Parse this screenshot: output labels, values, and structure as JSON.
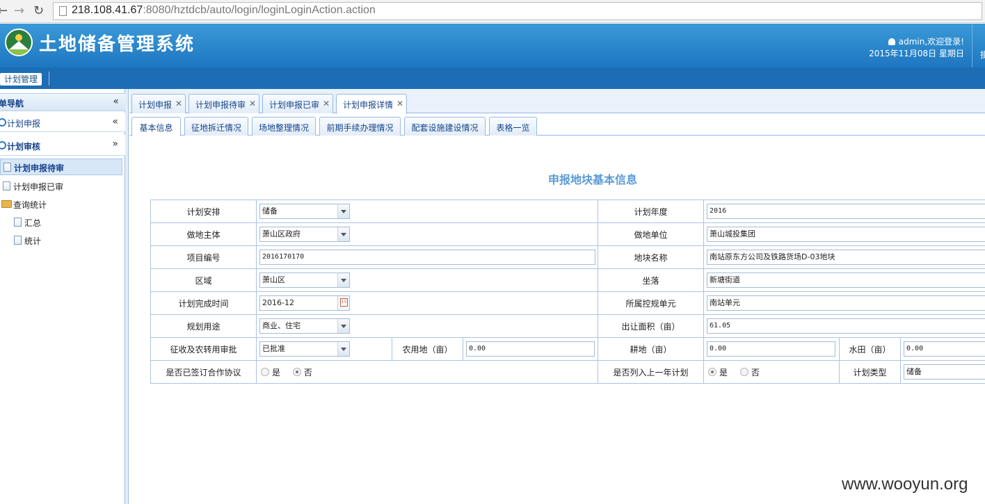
{
  "browser": {
    "url_host": "218.108.41.67",
    "url_rest": ":8080/hztdcb/auto/login/loginLoginAction.action"
  },
  "header": {
    "title": "土地储备管理系统",
    "user_greeting": "admin,欢迎登录!",
    "date": "2015年11月08日 星期日",
    "edge_text": "掛"
  },
  "module_bar": {
    "tab": "计划管理"
  },
  "sidebar": {
    "title": "菜单导航",
    "sections": [
      {
        "label": "计划申报"
      },
      {
        "label": "计划审核"
      }
    ],
    "tree": [
      {
        "label": "计划申报待审"
      },
      {
        "label": "计划申报已审"
      },
      {
        "label": "查询统计"
      },
      {
        "label": "汇总"
      },
      {
        "label": "统计"
      }
    ]
  },
  "tabs": [
    {
      "label": "计划申报"
    },
    {
      "label": "计划申报待审"
    },
    {
      "label": "计划申报已审"
    },
    {
      "label": "计划申报详情"
    }
  ],
  "subtabs": [
    {
      "label": "基本信息"
    },
    {
      "label": "征地拆迁情况"
    },
    {
      "label": "场地整理情况"
    },
    {
      "label": "前期手续办理情况"
    },
    {
      "label": "配套设施建设情况"
    },
    {
      "label": "表格一览"
    }
  ],
  "form": {
    "title": "申报地块基本信息",
    "plan_arrangement": {
      "label": "计划安排",
      "value": "储备"
    },
    "plan_year": {
      "label": "计划年度",
      "value": "2016"
    },
    "land_subject": {
      "label": "做地主体",
      "value": "萧山区政府"
    },
    "land_unit": {
      "label": "做地单位",
      "value": "萧山城投集团"
    },
    "project_no": {
      "label": "项目编号",
      "value": "2016170170"
    },
    "parcel_name": {
      "label": "地块名称",
      "value": "南站原东方公司及铁路货场D-03地块"
    },
    "area": {
      "label": "区域",
      "value": "萧山区"
    },
    "location": {
      "label": "坐落",
      "value": "新塘街道"
    },
    "completion_time": {
      "label": "计划完成时间",
      "value": "2016-12"
    },
    "control_unit": {
      "label": "所属控规单元",
      "value": "南站单元"
    },
    "planned_use": {
      "label": "规划用途",
      "value": "商业、住宅"
    },
    "transfer_area": {
      "label": "出让面积（亩）",
      "value": "61.05"
    },
    "approval": {
      "label": "征收及农转用审批",
      "value": "已批准"
    },
    "farmland": {
      "label": "农用地（亩）",
      "value": "0.00"
    },
    "cultivated": {
      "label": "耕地（亩）",
      "value": "0.00"
    },
    "paddy": {
      "label": "水田（亩）",
      "value": "0.00"
    },
    "signed_agreement": {
      "label": "是否已签订合作协议",
      "yes": "是",
      "no": "否"
    },
    "in_last_year": {
      "label": "是否列入上一年计划",
      "yes": "是",
      "no": "否"
    },
    "plan_type": {
      "label": "计划类型",
      "value": "储备"
    }
  },
  "watermark": "www.wooyun.org"
}
